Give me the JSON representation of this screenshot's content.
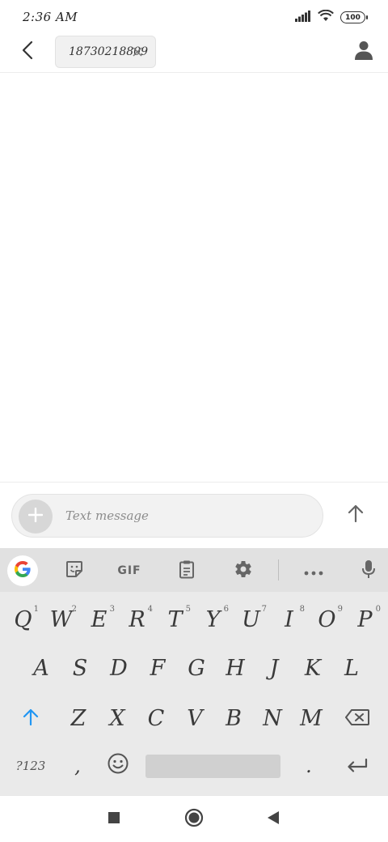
{
  "status_bar": {
    "time": "2:36 AM",
    "battery": "100",
    "icons": [
      "signal-icon",
      "wifi-icon",
      "battery-icon"
    ]
  },
  "header": {
    "recipient": "18730218809",
    "icons": [
      "back-arrow-icon",
      "close-icon",
      "contact-icon"
    ]
  },
  "compose": {
    "placeholder": "Text message",
    "icons": [
      "plus-icon",
      "send-arrow-icon"
    ]
  },
  "keyboard": {
    "toolbar": {
      "gif_label": "GIF",
      "icons": [
        "google-icon",
        "sticker-icon",
        "clipboard-icon",
        "gear-icon",
        "more-dots-icon",
        "microphone-icon"
      ]
    },
    "row1": [
      {
        "key": "Q",
        "hint": "1"
      },
      {
        "key": "W",
        "hint": "2"
      },
      {
        "key": "E",
        "hint": "3"
      },
      {
        "key": "R",
        "hint": "4"
      },
      {
        "key": "T",
        "hint": "5"
      },
      {
        "key": "Y",
        "hint": "6"
      },
      {
        "key": "U",
        "hint": "7"
      },
      {
        "key": "I",
        "hint": "8"
      },
      {
        "key": "O",
        "hint": "9"
      },
      {
        "key": "P",
        "hint": "0"
      }
    ],
    "row2": [
      "A",
      "S",
      "D",
      "F",
      "G",
      "H",
      "J",
      "K",
      "L"
    ],
    "row3": [
      "Z",
      "X",
      "C",
      "V",
      "B",
      "N",
      "M"
    ],
    "row4": {
      "symbols": "?123",
      "comma": ",",
      "period": "."
    },
    "colors": {
      "shift_accent": "#2196f3",
      "toolbar_bg": "#e1e1e1",
      "keyboard_bg": "#eaeaea"
    }
  },
  "nav_bar": {
    "icons": [
      "recents-square-icon",
      "home-circle-icon",
      "back-triangle-icon"
    ]
  }
}
